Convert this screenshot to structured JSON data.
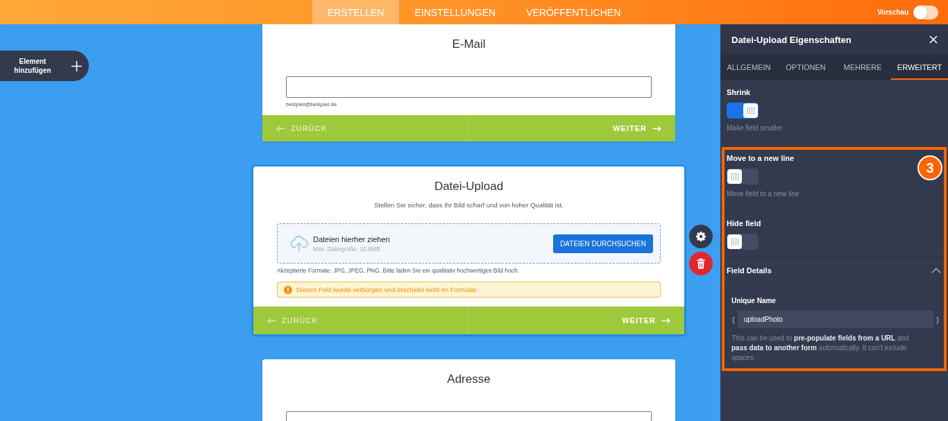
{
  "top_bar": {
    "tabs": [
      {
        "label": "ERSTELLEN",
        "selected": true
      },
      {
        "label": "EINSTELLUNGEN",
        "selected": false
      },
      {
        "label": "VERÖFFENTLICHEN",
        "selected": false
      }
    ],
    "preview": {
      "label": "Vorschau",
      "on": false
    }
  },
  "add_element": {
    "label": "Element hinzufügen"
  },
  "form": {
    "cards": [
      {
        "kind": "text_input",
        "title": "E-Mail",
        "selected": false,
        "sublabel": "beispiel@beispiel.de",
        "back": "ZURÜCK",
        "next": "WEITER"
      },
      {
        "kind": "file_upload",
        "title": "Datei-Upload",
        "selected": true,
        "description": "Stellen Sie sicher, dass Ihr Bild scharf und von hoher Qualität ist.",
        "dropzone": {
          "title": "Dateien hierher ziehen",
          "max_size": "Max. Dateigröße: 10.6MB",
          "button": "DATEIEN DURCHSUCHEN"
        },
        "formats": "Akzeptierte Formate: JPG, JPEG, PNG. Bitte laden Sie ein qualitativ hochwertiges Bild hoch.",
        "notice": "Dieses Feld wurde verborgen und erscheint nicht im Formular.",
        "back": "ZURÜCK",
        "next": "WEITER"
      },
      {
        "kind": "text_input",
        "title": "Adresse",
        "selected": false
      }
    ]
  },
  "properties_panel": {
    "title": "Datei-Upload Eigenschaften",
    "tabs": [
      {
        "label": "ALLGEMEIN",
        "selected": false
      },
      {
        "label": "OPTIONEN",
        "selected": false
      },
      {
        "label": "MEHRERE",
        "selected": false
      },
      {
        "label": "ERWEITERT",
        "selected": true
      }
    ],
    "settings": [
      {
        "kind": "toggle",
        "label": "Shrink",
        "on": true,
        "description": "Make field smaller"
      }
    ],
    "highlight": {
      "step": "3",
      "settings": [
        {
          "kind": "toggle",
          "label": "Move to a new line",
          "on": false,
          "description": "Move field to a new line"
        },
        {
          "kind": "toggle",
          "label": "Hide field",
          "on": false
        },
        {
          "kind": "section",
          "label": "Field Details",
          "expanded": true,
          "field": {
            "label": "Unique Name",
            "prefix": "{",
            "value": "uploadPhoto",
            "suffix": "}"
          },
          "help": "This can be used to **pre-populate fields from a URL** and **pass data to another form** automatically. It can't include spaces."
        }
      ]
    }
  }
}
